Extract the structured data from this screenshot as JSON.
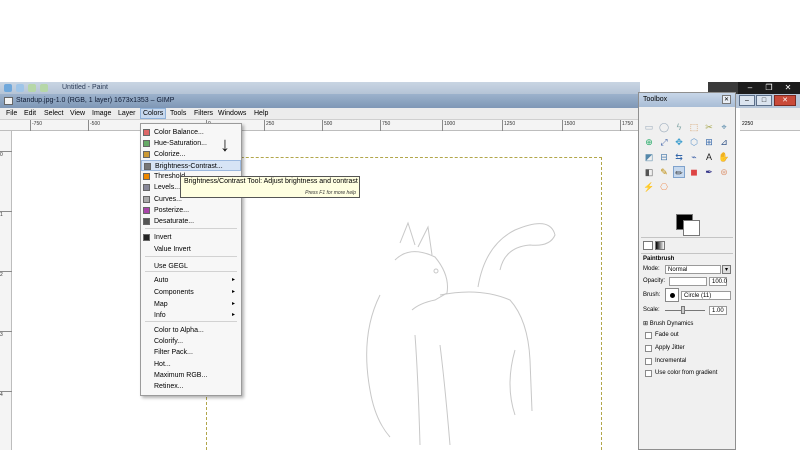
{
  "paint": {
    "title": "Untitled - Paint"
  },
  "gimp": {
    "title": "Standup.jpg-1.0 (RGB, 1 layer) 1673x1353 – GIMP",
    "menus": [
      "File",
      "Edit",
      "Select",
      "View",
      "Image",
      "Layer",
      "Colors",
      "Tools",
      "Filters",
      "Windows",
      "Help"
    ],
    "active_menu": "Colors",
    "ruler_top": [
      "-750",
      "-500",
      "-250",
      "0",
      "250",
      "500",
      "750",
      "1000",
      "1250",
      "1500",
      "1750",
      "2000",
      "2250"
    ],
    "ruler_left": [
      "0",
      "1",
      "2",
      "3",
      "4",
      "5"
    ]
  },
  "colors_menu": {
    "items": [
      {
        "label": "Color Balance...",
        "icon": "color-balance-icon"
      },
      {
        "label": "Hue-Saturation...",
        "icon": "hue-saturation-icon"
      },
      {
        "label": "Colorize...",
        "icon": "colorize-icon"
      },
      {
        "label": "Brightness-Contrast...",
        "icon": "brightness-contrast-icon"
      },
      {
        "label": "Threshold...",
        "icon": "threshold-icon"
      },
      {
        "label": "Levels...",
        "icon": "levels-icon"
      },
      {
        "label": "Curves...",
        "icon": "curves-icon"
      },
      {
        "label": "Posterize...",
        "icon": "posterize-icon"
      },
      {
        "label": "Desaturate...",
        "icon": "desaturate-icon"
      },
      {
        "label": "Invert",
        "icon": "invert-icon"
      },
      {
        "label": "Value Invert",
        "icon": ""
      },
      {
        "label": "Use GEGL",
        "icon": ""
      },
      {
        "label": "Auto",
        "icon": ""
      },
      {
        "label": "Components",
        "icon": ""
      },
      {
        "label": "Map",
        "icon": ""
      },
      {
        "label": "Info",
        "icon": ""
      },
      {
        "label": "Color to Alpha...",
        "icon": ""
      },
      {
        "label": "Colorify...",
        "icon": ""
      },
      {
        "label": "Filter Pack...",
        "icon": ""
      },
      {
        "label": "Hot...",
        "icon": ""
      },
      {
        "label": "Maximum RGB...",
        "icon": ""
      },
      {
        "label": "Retinex...",
        "icon": ""
      }
    ],
    "hover_index": 3
  },
  "tooltip": {
    "text": "Brightness/Contrast Tool: Adjust brightness and contrast",
    "hint": "Press F1 for more help"
  },
  "toolbox": {
    "title": "Toolbox",
    "panel_title": "Paintbrush",
    "mode_label": "Mode:",
    "mode_value": "Normal",
    "opacity_label": "Opacity:",
    "opacity_value": "100.0",
    "brush_label": "Brush:",
    "brush_value": "Circle (11)",
    "scale_label": "Scale:",
    "scale_value": "1.00",
    "brush_dynamics": "Brush Dynamics",
    "checkboxes": [
      "Fade out",
      "Apply Jitter",
      "Incremental",
      "Use color from gradient"
    ]
  }
}
